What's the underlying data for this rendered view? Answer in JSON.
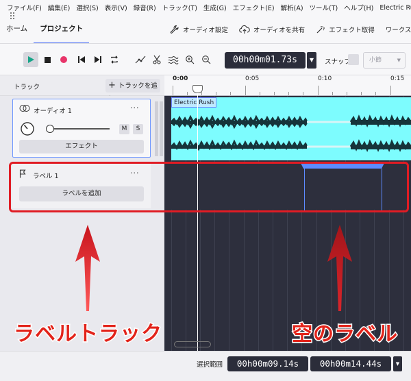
{
  "menubar": {
    "items": [
      "ファイル(F)",
      "編集(E)",
      "選択(S)",
      "表示(V)",
      "録音(R)",
      "トラック(T)",
      "生成(G)",
      "エフェクト(E)",
      "解析(A)",
      "ツール(T)",
      "ヘルプ(H)"
    ],
    "project_title": "Electric Rush"
  },
  "tabs": {
    "home": "ホーム",
    "project": "プロジェクト",
    "audio_settings": "オーディオ設定",
    "share_audio": "オーディオを共有",
    "get_effects": "エフェクト取得",
    "workspace": "ワークスペース"
  },
  "toolbar": {
    "time": "00h00m01.73s",
    "snap_label": "スナップ",
    "snap_value": "小節"
  },
  "tracks_header": {
    "title": "トラック",
    "add_track": "トラックを追加"
  },
  "audio_track": {
    "name": "オーディオ 1",
    "mute": "M",
    "solo": "S",
    "effects_button": "エフェクト",
    "clip_name": "Electric Rush"
  },
  "label_track": {
    "name": "ラベル 1",
    "add_label_button": "ラベルを追加"
  },
  "ruler": {
    "labels": [
      "0:00",
      "0:05",
      "0:10",
      "0:15"
    ]
  },
  "annotations": {
    "left": "ラベルトラック",
    "right": "空のラベル"
  },
  "status": {
    "selection_label": "選択範囲",
    "start": "00h00m09.14s",
    "end": "00h00m14.44s"
  },
  "colors": {
    "accent": "#4a6cf7",
    "waveform_bg": "#7dfcfe",
    "canvas": "#2d2f3d",
    "annotation_red": "#e2231a",
    "label_blue": "#5d8bff"
  }
}
